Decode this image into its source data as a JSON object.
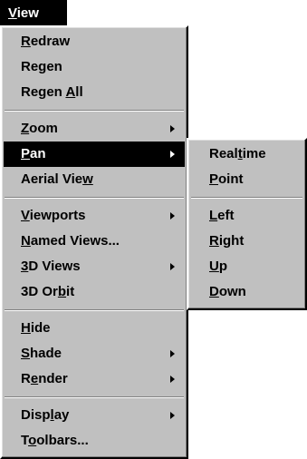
{
  "menubar": {
    "title": {
      "before": "",
      "access": "V",
      "after": "iew"
    }
  },
  "view_menu": {
    "groups": [
      {
        "items": [
          {
            "before": "",
            "access": "R",
            "after": "edraw",
            "submenu": false
          },
          {
            "before": "Regen",
            "access": "",
            "after": "",
            "submenu": false
          },
          {
            "before": "Regen ",
            "access": "A",
            "after": "ll",
            "submenu": false
          }
        ]
      },
      {
        "items": [
          {
            "before": "",
            "access": "Z",
            "after": "oom",
            "submenu": true
          },
          {
            "before": "",
            "access": "P",
            "after": "an",
            "submenu": true,
            "active": true
          },
          {
            "before": "Aerial Vie",
            "access": "w",
            "after": "",
            "submenu": false
          }
        ]
      },
      {
        "items": [
          {
            "before": "",
            "access": "V",
            "after": "iewports",
            "submenu": true
          },
          {
            "before": "",
            "access": "N",
            "after": "amed Views...",
            "submenu": false
          },
          {
            "before": "",
            "access": "3",
            "after": "D Views",
            "submenu": true
          },
          {
            "before": "3D Or",
            "access": "b",
            "after": "it",
            "submenu": false
          }
        ]
      },
      {
        "items": [
          {
            "before": "",
            "access": "H",
            "after": "ide",
            "submenu": false
          },
          {
            "before": "",
            "access": "S",
            "after": "hade",
            "submenu": true
          },
          {
            "before": "R",
            "access": "e",
            "after": "nder",
            "submenu": true
          }
        ]
      },
      {
        "items": [
          {
            "before": "Disp",
            "access": "l",
            "after": "ay",
            "submenu": true
          },
          {
            "before": "T",
            "access": "o",
            "after": "olbars...",
            "submenu": false
          }
        ]
      }
    ]
  },
  "pan_submenu": {
    "groups": [
      {
        "items": [
          {
            "before": "Real",
            "access": "t",
            "after": "ime"
          },
          {
            "before": "",
            "access": "P",
            "after": "oint"
          }
        ]
      },
      {
        "items": [
          {
            "before": "",
            "access": "L",
            "after": "eft"
          },
          {
            "before": "",
            "access": "R",
            "after": "ight"
          },
          {
            "before": "",
            "access": "U",
            "after": "p"
          },
          {
            "before": "",
            "access": "D",
            "after": "own"
          }
        ]
      }
    ]
  },
  "colors": {
    "menu_face": "#c0c0c0",
    "highlight_bg": "#000000",
    "highlight_text": "#ffffff",
    "bevel_light": "#ffffff",
    "bevel_dark": "#808080"
  }
}
